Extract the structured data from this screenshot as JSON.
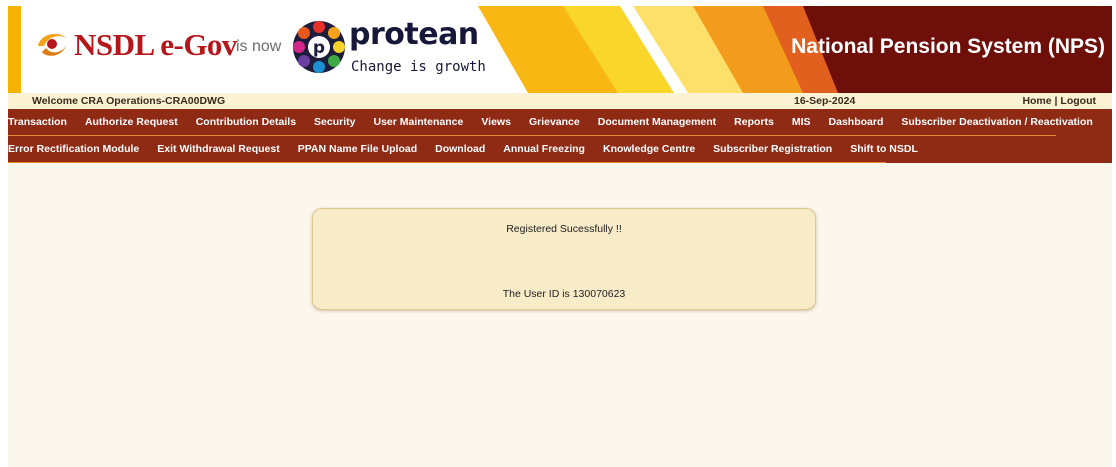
{
  "banner": {
    "nsdl_brand": "NSDL e-Gov",
    "is_now": "is now",
    "protean_name": "protean",
    "protean_tagline": "Change is growth",
    "system_title": "National Pension System (NPS)"
  },
  "welcome_bar": {
    "welcome_text": "Welcome CRA Operations-CRA00DWG",
    "date": "16-Sep-2024",
    "home_link": "Home",
    "separator": "|",
    "logout_link": "Logout"
  },
  "menu": {
    "row1": [
      "Transaction",
      "Authorize Request",
      "Contribution Details",
      "Security",
      "User Maintenance",
      "Views",
      "Grievance",
      "Document Management",
      "Reports",
      "MIS",
      "Dashboard",
      "Subscriber Deactivation / Reactivation"
    ],
    "row2": [
      "Error Rectification Module",
      "Exit Withdrawal Request",
      "PPAN Name File Upload",
      "Download",
      "Annual Freezing",
      "Knowledge Centre",
      "Subscriber Registration",
      "Shift to NSDL"
    ]
  },
  "message": {
    "status": "Registered Sucessfully !!",
    "user_id_text": "The User ID is 130070623"
  },
  "colors": {
    "menu_bg": "#8f2a15",
    "banner_dark_red": "#6e0f0a",
    "banner_yellow": "#f6b200",
    "page_bg": "#fbf7ec",
    "message_bg": "#f8ebc8"
  }
}
